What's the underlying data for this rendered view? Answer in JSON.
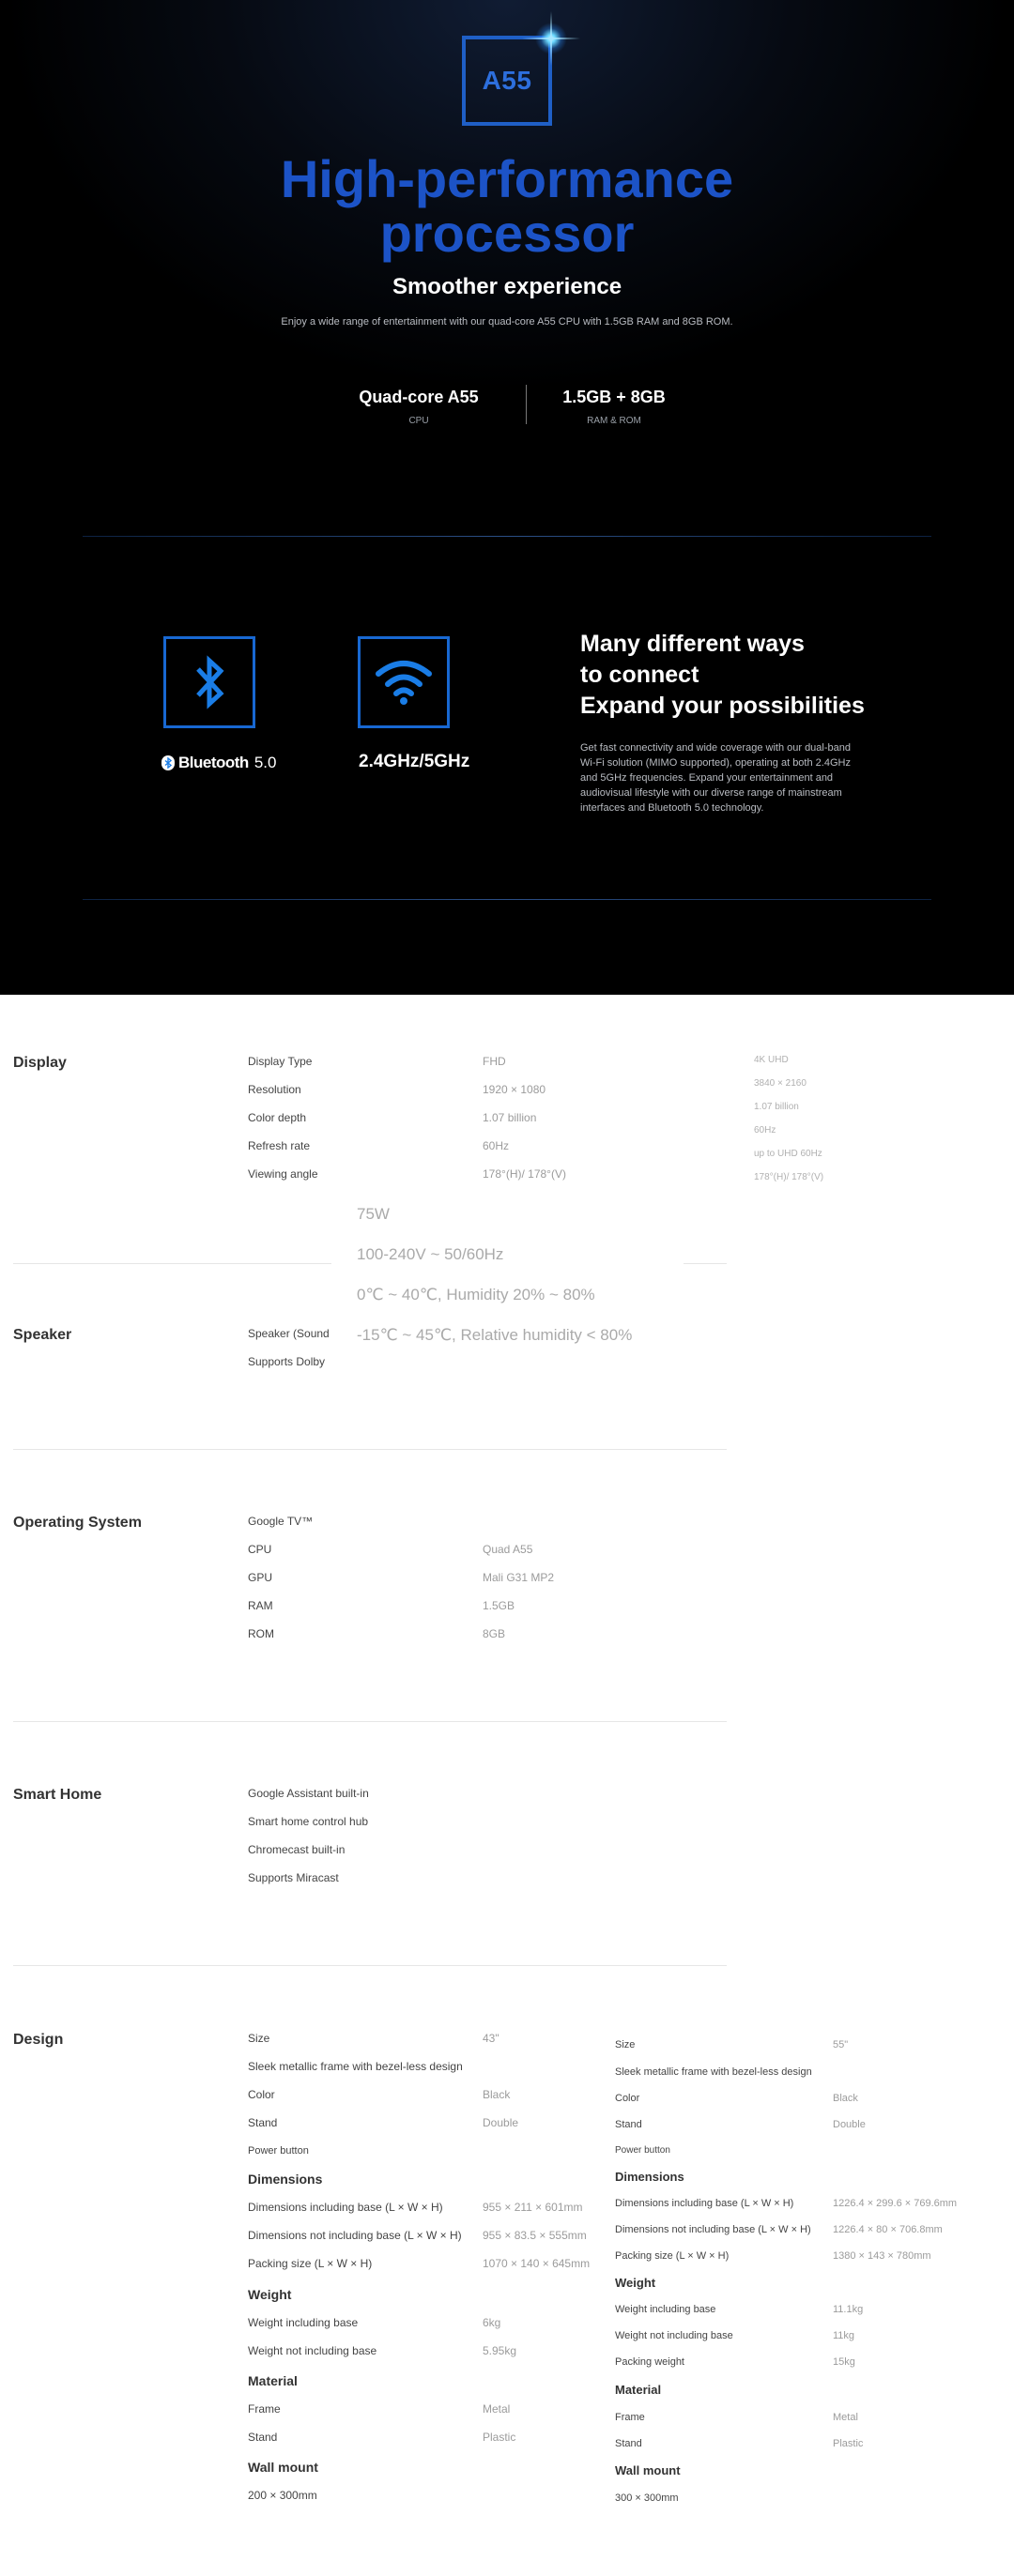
{
  "hero": {
    "chip_label": "A55",
    "title_line1": "High-performance",
    "title_line2": "processor",
    "subtitle": "Smoother experience",
    "description": "Enjoy a wide range of entertainment with our quad-core A55 CPU with 1.5GB RAM and 8GB ROM.",
    "specs": [
      {
        "value": "Quad-core A55",
        "label": "CPU"
      },
      {
        "value": "1.5GB + 8GB",
        "label": "RAM & ROM"
      }
    ]
  },
  "connect": {
    "bluetooth_brand": "Bluetooth",
    "bluetooth_version": "5.0",
    "wifi_label": "2.4GHz/5GHz",
    "title_line1": "Many different ways",
    "title_line2": "to connect",
    "title_line3": "Expand your possibilities",
    "description": "Get fast connectivity and wide coverage with our dual-band Wi-Fi solution (MIMO supported), operating at both 2.4GHz and 5GHz frequencies. Expand your entertainment and audiovisual lifestyle with our diverse range of mainstream interfaces and Bluetooth 5.0 technology."
  },
  "display": {
    "title": "Display",
    "rows": [
      {
        "label": "Display Type",
        "fhd": "FHD",
        "uhd": "4K UHD"
      },
      {
        "label": "Resolution",
        "fhd": "1920 × 1080",
        "uhd": "3840 × 2160"
      },
      {
        "label": "Color depth",
        "fhd": "1.07 billion",
        "uhd": "1.07 billion"
      },
      {
        "label": "Refresh rate",
        "fhd": "60Hz",
        "uhd": "60Hz"
      },
      {
        "label": "Viewing angle",
        "fhd": "178°(H)/ 178°(V)",
        "uhd": "up to UHD 60Hz"
      }
    ],
    "uhd_extra": "178°(H)/ 178°(V)"
  },
  "overlay": {
    "lines": [
      "75W",
      "100-240V ~ 50/60Hz",
      "0℃ ~ 40℃, Humidity 20% ~ 80%",
      "-15℃ ~ 45℃, Relative humidity < 80%"
    ]
  },
  "speaker": {
    "title": "Speaker",
    "rows": [
      "Speaker (Sound",
      "Supports Dolby"
    ]
  },
  "os": {
    "title": "Operating System",
    "rows": [
      {
        "label": "Google TV™",
        "value": ""
      },
      {
        "label": "CPU",
        "value": "Quad A55"
      },
      {
        "label": "GPU",
        "value": "Mali G31 MP2"
      },
      {
        "label": "RAM",
        "value": "1.5GB"
      },
      {
        "label": "ROM",
        "value": "8GB"
      }
    ]
  },
  "smart": {
    "title": "Smart Home",
    "rows": [
      "Google Assistant built-in",
      "Smart home control hub",
      "Chromecast built-in",
      "Supports Miracast"
    ]
  },
  "design": {
    "title": "Design",
    "left": {
      "size_label": "Size",
      "size_value": "43\"",
      "frame_desc": "Sleek metallic frame with bezel-less design",
      "color_label": "Color",
      "color_value": "Black",
      "stand_label": "Stand",
      "stand_value": "Double",
      "power": "Power button",
      "dim_head": "Dimensions",
      "dim_incl_label": "Dimensions including base (L × W × H)",
      "dim_incl_value": "955 × 211 × 601mm",
      "dim_excl_label": "Dimensions not including base (L × W × H)",
      "dim_excl_value": "955 × 83.5 × 555mm",
      "pack_label": "Packing size (L × W × H)",
      "pack_value": "1070 × 140 × 645mm",
      "weight_head": "Weight",
      "w_incl_label": "Weight including base",
      "w_incl_value": "6kg",
      "w_excl_label": "Weight not including base",
      "w_excl_value": "5.95kg",
      "material_head": "Material",
      "frame_label": "Frame",
      "frame_value": "Metal",
      "mstand_label": "Stand",
      "mstand_value": "Plastic",
      "wall_head": "Wall mount",
      "wall_value": "200 × 300mm"
    },
    "right": {
      "size_label": "Size",
      "size_value": "55\"",
      "frame_desc": "Sleek metallic frame with bezel-less design",
      "color_label": "Color",
      "color_value": "Black",
      "stand_label": "Stand",
      "stand_value": "Double",
      "power": "Power button",
      "dim_head": "Dimensions",
      "dim_incl_label": "Dimensions including base (L × W × H)",
      "dim_incl_value": "1226.4 × 299.6 × 769.6mm",
      "dim_excl_label": "Dimensions not including base (L × W × H)",
      "dim_excl_value": "1226.4 × 80 × 706.8mm",
      "pack_label": "Packing size (L × W × H)",
      "pack_value": "1380 × 143 × 780mm",
      "weight_head": "Weight",
      "w_incl_label": "Weight including base",
      "w_incl_value": "11.1kg",
      "w_excl_label": "Weight not including base",
      "w_excl_value": "11kg",
      "pack_w_label": "Packing weight",
      "pack_w_value": "15kg",
      "material_head": "Material",
      "frame_label": "Frame",
      "frame_value": "Metal",
      "mstand_label": "Stand",
      "mstand_value": "Plastic",
      "wall_head": "Wall mount",
      "wall_value": "300 × 300mm"
    }
  },
  "colors": {
    "accent_blue": "#1c53c7",
    "icon_blue": "#1868d2",
    "background_dark": "#000000"
  }
}
